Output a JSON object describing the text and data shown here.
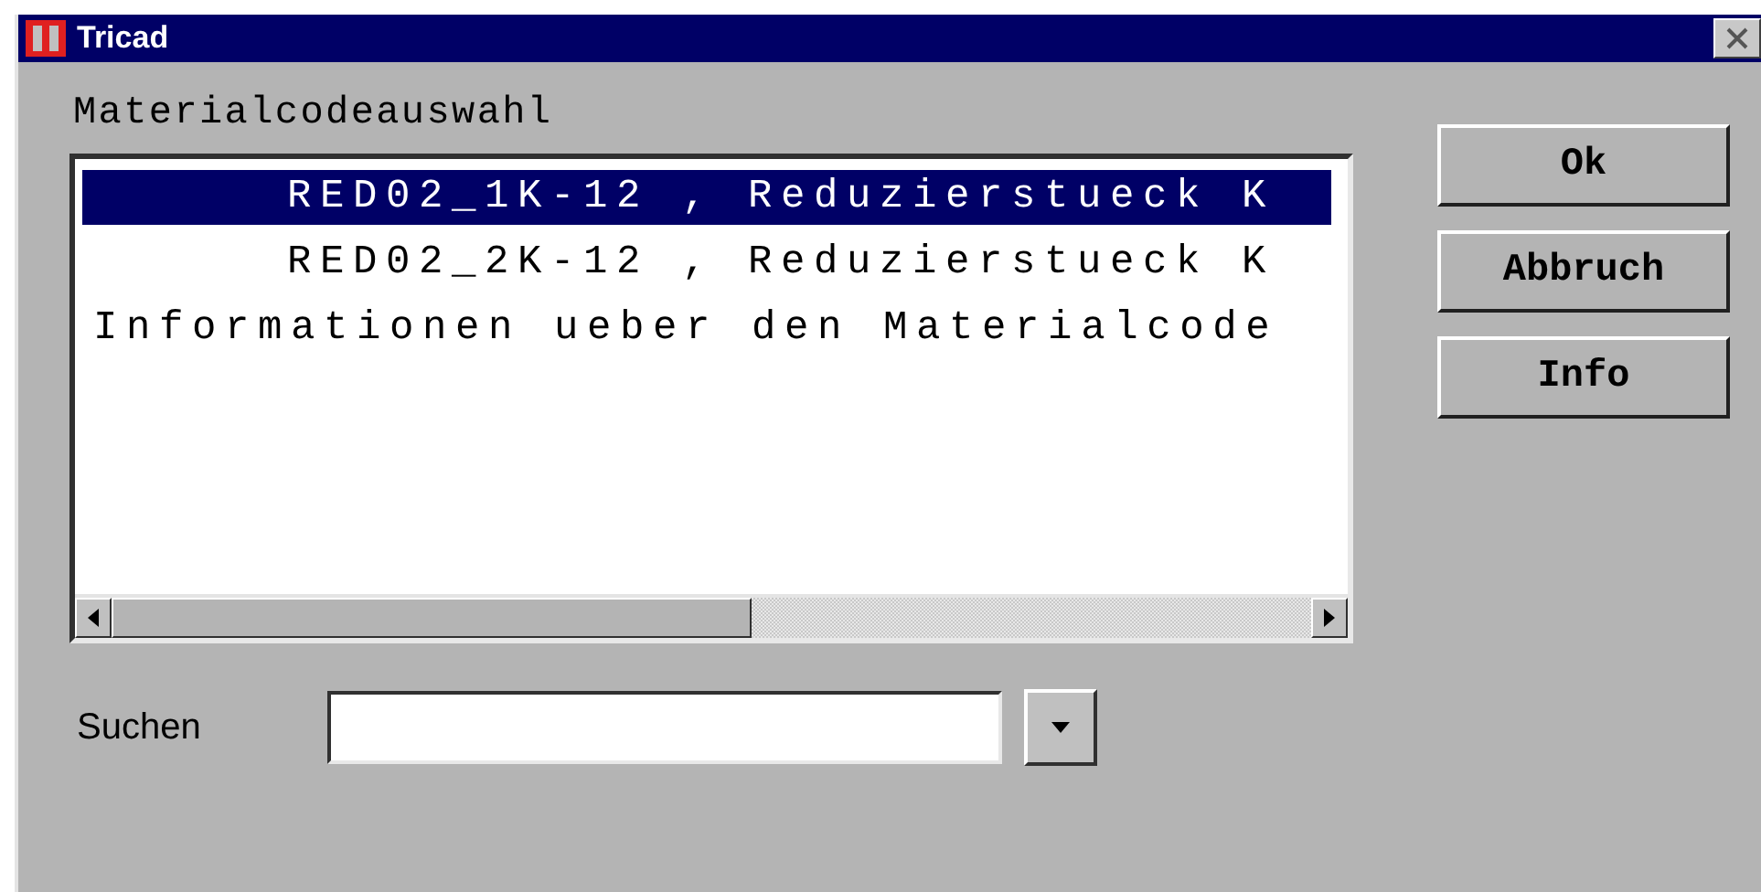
{
  "window": {
    "title": "Tricad"
  },
  "list": {
    "label": "Materialcodeauswahl",
    "items": [
      {
        "text": "RED02_1K-12 , Reduzierstueck K",
        "kind": "entry",
        "selected": true
      },
      {
        "text": "RED02_2K-12 , Reduzierstueck K",
        "kind": "entry",
        "selected": false
      },
      {
        "text": "Informationen ueber den Materialcode",
        "kind": "note",
        "selected": false
      }
    ]
  },
  "buttons": [
    "Ok",
    "Abbruch",
    "Info"
  ],
  "search": {
    "label": "Suchen"
  }
}
